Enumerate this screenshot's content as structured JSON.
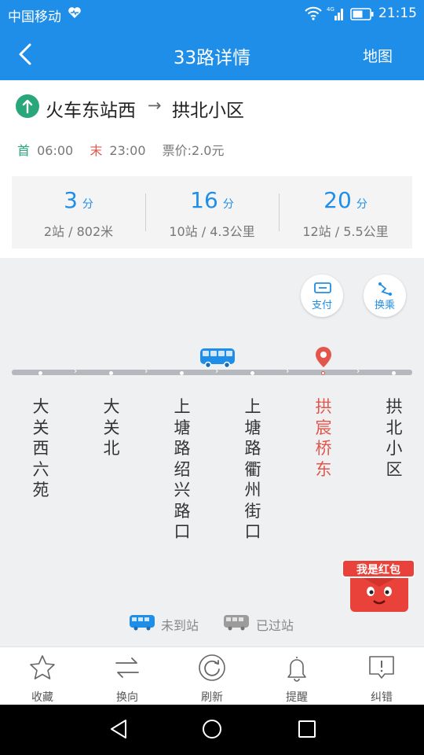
{
  "status_bar": {
    "carrier": "中国移动",
    "time": "21:15"
  },
  "nav": {
    "title": "33路详情",
    "map_label": "地图"
  },
  "route": {
    "from": "火车东站西",
    "arrow": "→",
    "to": "拱北小区"
  },
  "times": {
    "first_mark": "首",
    "first_time": "06:00",
    "last_mark": "末",
    "last_time": "23:00",
    "fare": "票价:2.0元"
  },
  "eta": [
    {
      "minutes": "3",
      "unit": "分",
      "detail": "2站 / 802米"
    },
    {
      "minutes": "16",
      "unit": "分",
      "detail": "10站 / 4.3公里"
    },
    {
      "minutes": "20",
      "unit": "分",
      "detail": "12站 / 5.5公里"
    }
  ],
  "actions": {
    "pay_label": "支付",
    "transfer_label": "换乘"
  },
  "stops": [
    {
      "name": "大关西六苑",
      "active": false
    },
    {
      "name": "大关北",
      "active": false
    },
    {
      "name": "上塘路绍兴路口",
      "active": false
    },
    {
      "name": "上塘路衢州街口",
      "active": false
    },
    {
      "name": "拱宸桥东",
      "active": true
    },
    {
      "name": "拱北小区",
      "active": false
    }
  ],
  "legend": {
    "not_arrived": "未到站",
    "passed": "已过站"
  },
  "promo": {
    "label": "我是红包"
  },
  "tabs": [
    {
      "label": "收藏",
      "icon": "star-icon"
    },
    {
      "label": "换向",
      "icon": "swap-icon"
    },
    {
      "label": "刷新",
      "icon": "refresh-icon"
    },
    {
      "label": "提醒",
      "icon": "bell-icon"
    },
    {
      "label": "纠错",
      "icon": "report-icon"
    }
  ],
  "colors": {
    "primary": "#1f8ee8",
    "active_stop": "#e2564c",
    "start_green": "#2aa77a"
  }
}
